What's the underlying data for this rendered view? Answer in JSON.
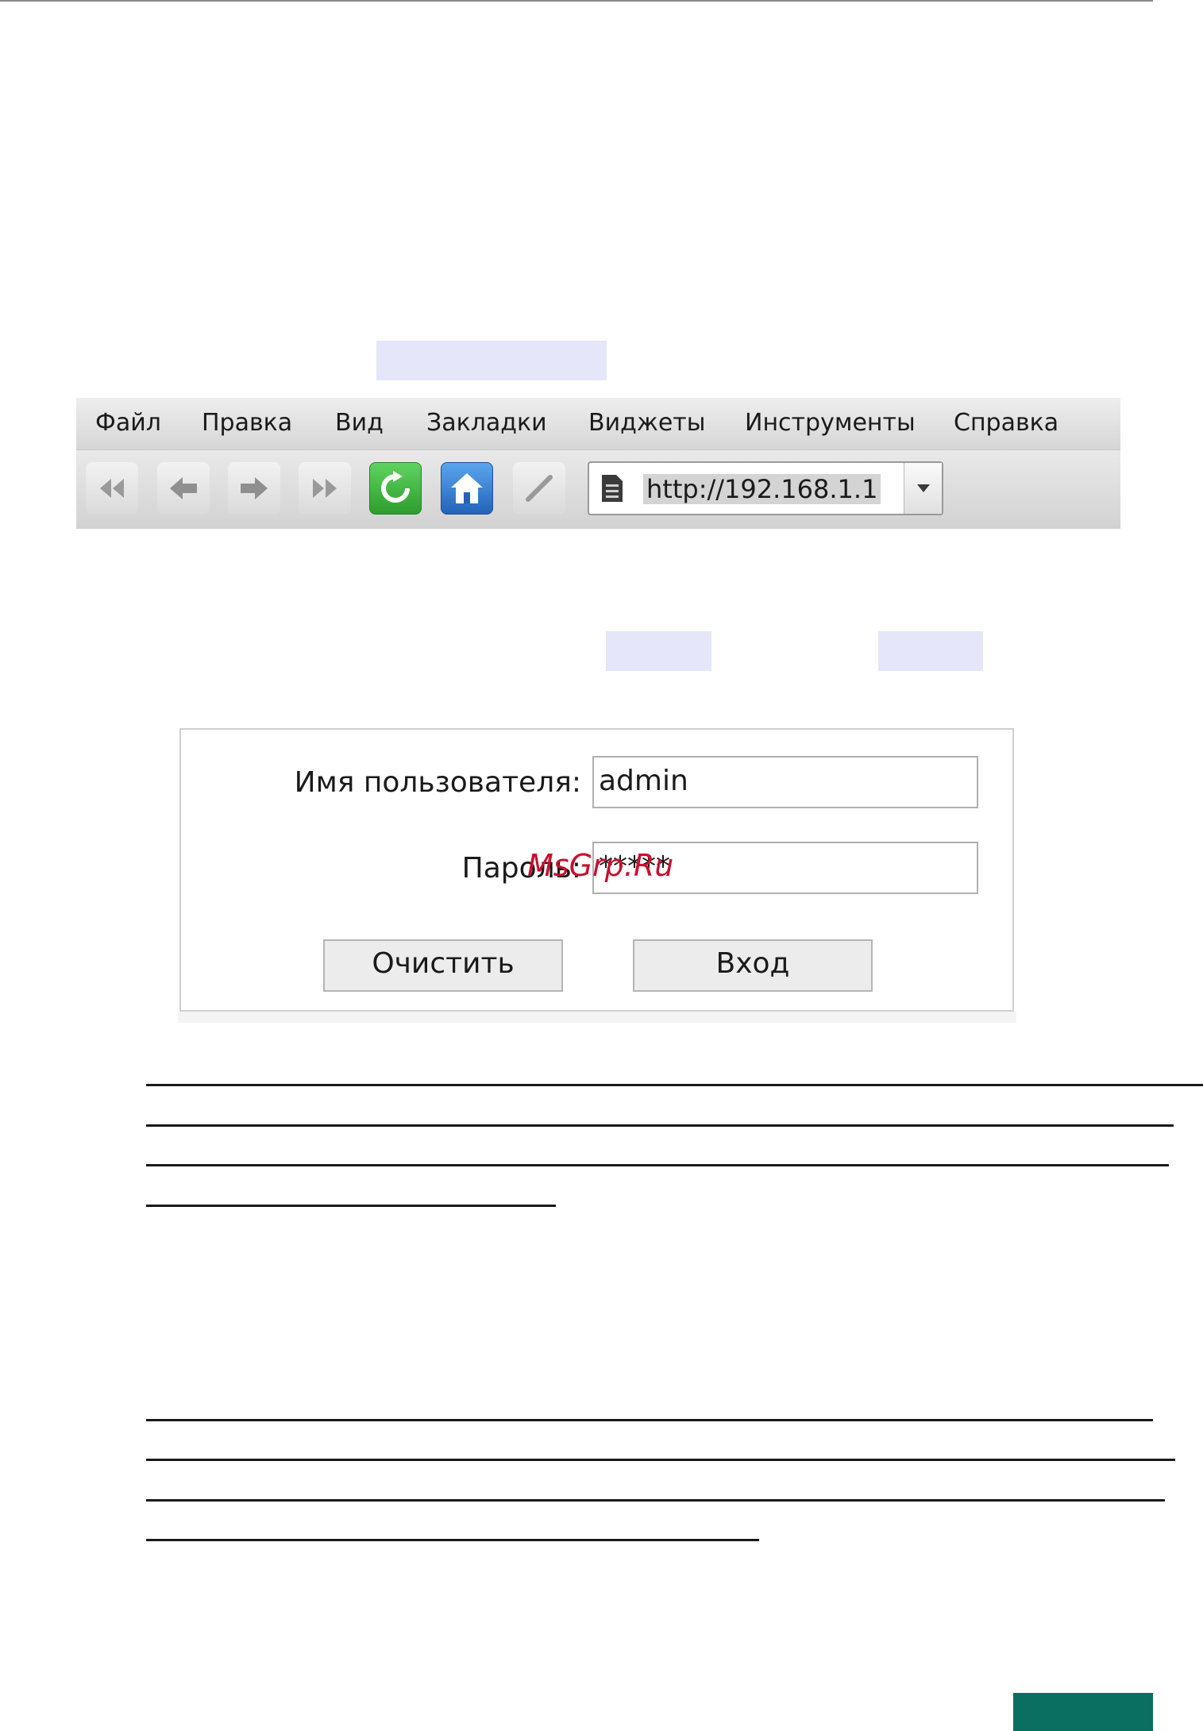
{
  "browser": {
    "menu": [
      "Файл",
      "Правка",
      "Вид",
      "Закладки",
      "Виджеты",
      "Инструменты",
      "Справка"
    ],
    "toolbar": {
      "icons": [
        "rewind-icon",
        "back-arrow-icon",
        "forward-arrow-icon",
        "fast-forward-icon",
        "refresh-icon",
        "home-icon",
        "pencil-icon"
      ],
      "address_url": "http://192.168.1.1"
    }
  },
  "login": {
    "username_label": "Имя пользователя:",
    "username_value": "admin",
    "password_label": "Пароль:",
    "password_value": "*****",
    "clear_button": "Очистить",
    "login_button": "Вход"
  },
  "watermark": "MsGrp.Ru",
  "colors": {
    "highlight": "#e6e6fa",
    "refresh_green": "#2e9d2e",
    "home_blue": "#2363b8",
    "watermark_red": "#c8102e",
    "corner_teal": "#0a6f60"
  }
}
